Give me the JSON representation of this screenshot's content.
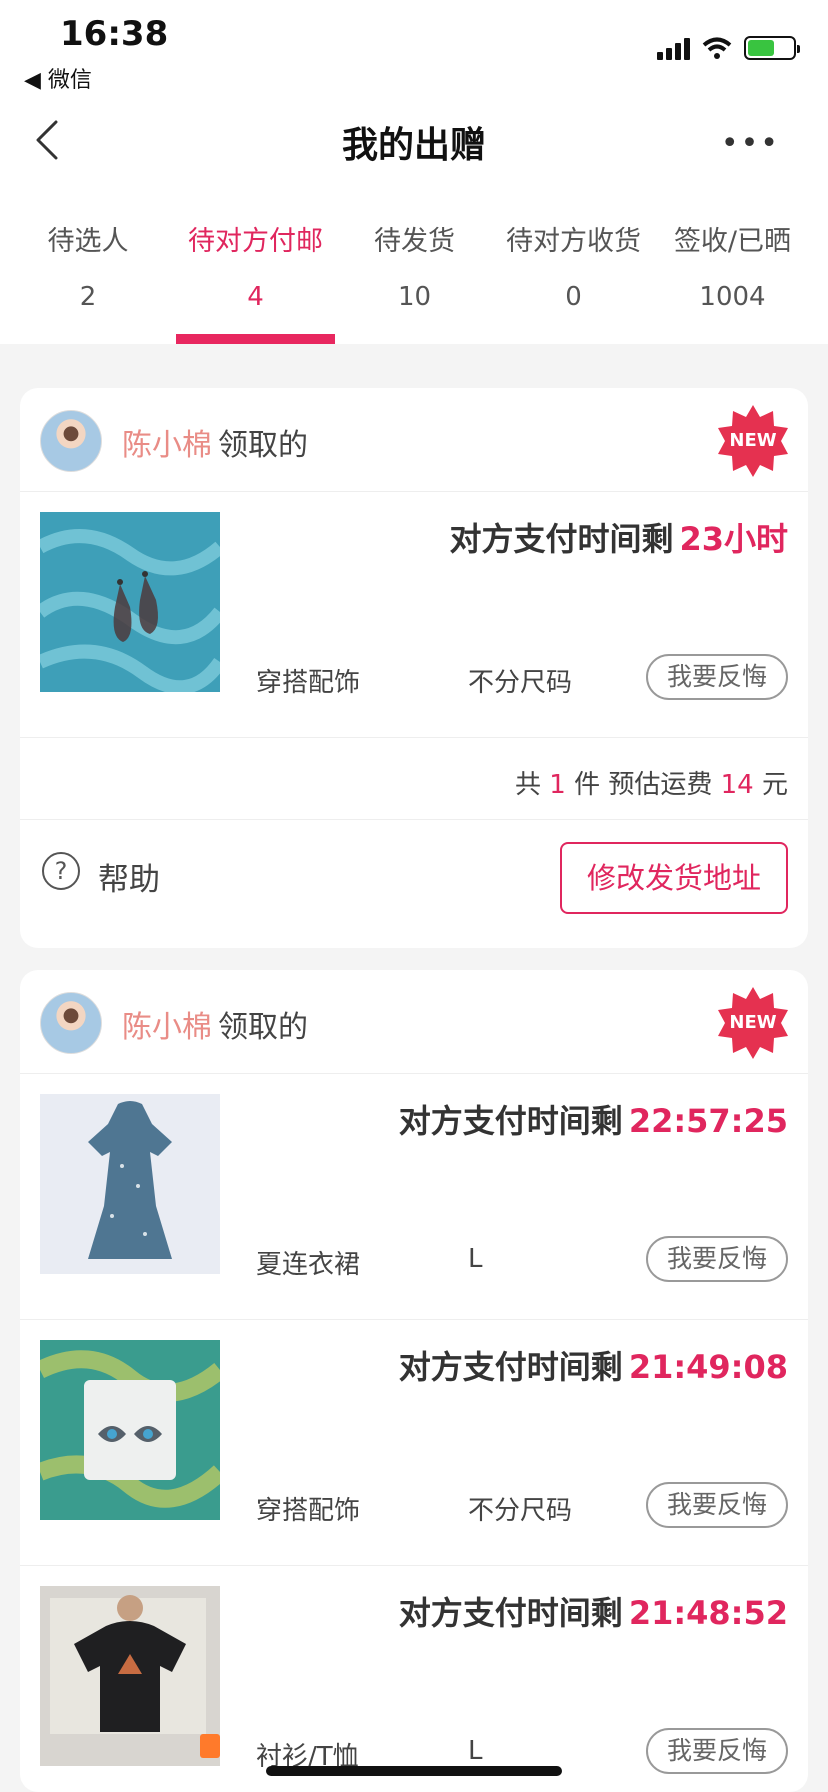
{
  "status_bar": {
    "time": "16:38",
    "back_app": "◀ 微信"
  },
  "header": {
    "title": "我的出赠",
    "more_icon": "more-icon"
  },
  "tabs": [
    {
      "label": "待选人",
      "count": "2"
    },
    {
      "label": "待对方付邮",
      "count": "4",
      "active": true
    },
    {
      "label": "待发货",
      "count": "10"
    },
    {
      "label": "待对方收货",
      "count": "0"
    },
    {
      "label": "签收/已晒",
      "count": "1004"
    }
  ],
  "colors": {
    "accent": "#e0265e",
    "claimer_name": "#e98c86",
    "new_badge": "#e53150"
  },
  "cards": [
    {
      "claimer_name": "陈小棉",
      "claimed_label": "领取的",
      "badge": "NEW",
      "items": [
        {
          "pay_prefix": "对方支付时间剩",
          "pay_left": "23小时",
          "category": "穿搭配饰",
          "size": "不分尺码",
          "regret_button": "我要反悔",
          "thumbnail": "earrings-photo"
        }
      ],
      "summary": {
        "prefix": "共",
        "count": "1",
        "unit": "件 预估运费",
        "fee": "14",
        "currency": "元"
      },
      "help_label": "帮助",
      "address_button": "修改发货地址"
    },
    {
      "claimer_name": "陈小棉",
      "claimed_label": "领取的",
      "badge": "NEW",
      "items": [
        {
          "pay_prefix": "对方支付时间剩",
          "pay_left": "22:57:25",
          "category": "夏连衣裙",
          "size": "L",
          "regret_button": "我要反悔",
          "thumbnail": "dress-photo"
        },
        {
          "pay_prefix": "对方支付时间剩",
          "pay_left": "21:49:08",
          "category": "穿搭配饰",
          "size": "不分尺码",
          "regret_button": "我要反悔",
          "thumbnail": "stud-earrings-photo"
        },
        {
          "pay_prefix": "对方支付时间剩",
          "pay_left": "21:48:52",
          "category": "衬衫/T恤",
          "size": "L",
          "regret_button": "我要反悔",
          "thumbnail": "tshirt-photo"
        }
      ]
    }
  ]
}
